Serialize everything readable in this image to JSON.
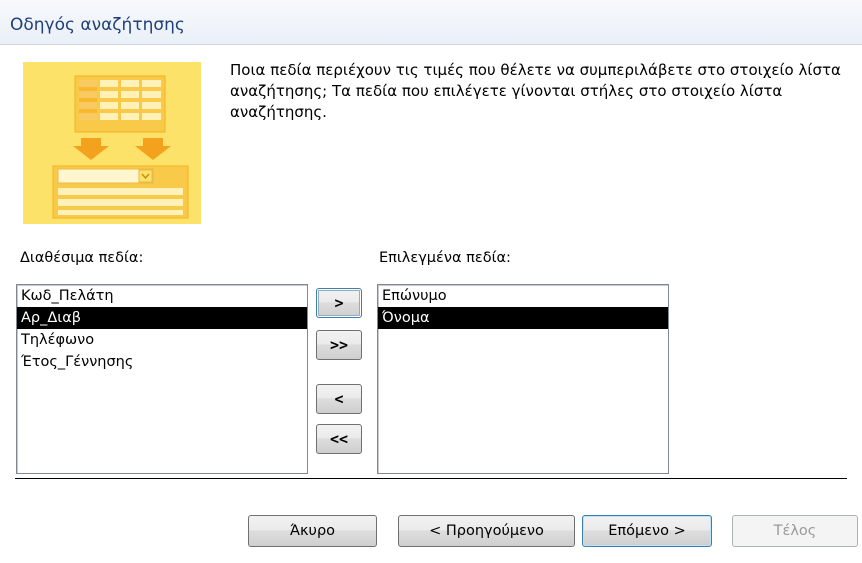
{
  "window": {
    "title": "Οδηγός αναζήτησης"
  },
  "instructions": "Ποια πεδία περιέχουν τις τιμές που θέλετε να συμπεριλάβετε στο στοιχείο λίστα αναζήτησης; Τα πεδία που επιλέγετε γίνονται στήλες στο στοιχείο λίστα αναζήτησης.",
  "available": {
    "label": "Διαθέσιμα πεδία:",
    "items": [
      "Κωδ_Πελάτη",
      "Αρ_Διαβ",
      "Τηλέφωνο",
      "Έτος_Γέννησης"
    ],
    "selected_item": "Αρ_Διαβ"
  },
  "selected": {
    "label": "Επιλεγμένα πεδία:",
    "items": [
      "Επώνυμο",
      "Όνομα"
    ],
    "selected_item": "Όνομα"
  },
  "move_buttons": {
    "add_one": ">",
    "add_all": ">>",
    "remove_one": "<",
    "remove_all": "<<"
  },
  "footer": {
    "cancel": "Άκυρο",
    "back": "< Προηγούμενο",
    "next": "Επόμενο >",
    "finish": "Τέλος"
  },
  "colors": {
    "hero_bg": "#fde26a",
    "hero_accent": "#f5b31c",
    "selection": "#000000"
  }
}
